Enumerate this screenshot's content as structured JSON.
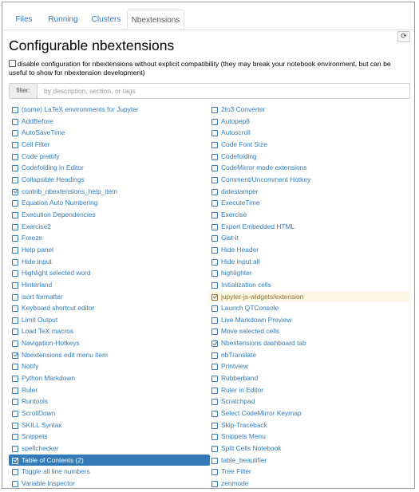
{
  "tabs": [
    {
      "label": "Files"
    },
    {
      "label": "Running"
    },
    {
      "label": "Clusters"
    },
    {
      "label": "Nbextensions",
      "active": true
    }
  ],
  "page_title": "Configurable nbextensions",
  "refresh_icon": "refresh-icon",
  "compat_checkbox": {
    "checked": false,
    "label": "disable configuration for nbextensions without explicit compatibility (they may break your notebook environment, but can be useful to show for nbextension development)"
  },
  "filter": {
    "label": "filter:",
    "value": "",
    "placeholder": "by description, section, or tags"
  },
  "colors": {
    "link": "#337ab7",
    "selected_bg": "#337ab7",
    "hover_bg": "#fcf8e3",
    "hover_text": "#8a6d3b"
  },
  "extensions_left": [
    {
      "label": "(some) LaTeX environments for Jupyter",
      "checked": false
    },
    {
      "label": "AddBefore",
      "checked": false
    },
    {
      "label": "AutoSaveTime",
      "checked": false
    },
    {
      "label": "Cell Filter",
      "checked": false
    },
    {
      "label": "Code prettify",
      "checked": false
    },
    {
      "label": "Codefolding in Editor",
      "checked": false
    },
    {
      "label": "Collapsible Headings",
      "checked": false
    },
    {
      "label": "contrib_nbextensions_help_item",
      "checked": true
    },
    {
      "label": "Equation Auto Numbering",
      "checked": false
    },
    {
      "label": "Execution Dependencies",
      "checked": false
    },
    {
      "label": "Exercise2",
      "checked": false
    },
    {
      "label": "Freeze",
      "checked": false
    },
    {
      "label": "Help panel",
      "checked": false
    },
    {
      "label": "Hide input",
      "checked": false
    },
    {
      "label": "Highlight selected word",
      "checked": false
    },
    {
      "label": "Hinterland",
      "checked": false
    },
    {
      "label": "isort formatter",
      "checked": false
    },
    {
      "label": "Keyboard shortcut editor",
      "checked": false
    },
    {
      "label": "Limit Output",
      "checked": false
    },
    {
      "label": "Load TeX macros",
      "checked": false
    },
    {
      "label": "Navigation-Hotkeys",
      "checked": false
    },
    {
      "label": "Nbextensions edit menu item",
      "checked": true
    },
    {
      "label": "Notify",
      "checked": false
    },
    {
      "label": "Python Markdown",
      "checked": false
    },
    {
      "label": "Ruler",
      "checked": false
    },
    {
      "label": "Runtools",
      "checked": false
    },
    {
      "label": "ScrollDown",
      "checked": false
    },
    {
      "label": "SKILL Syntax",
      "checked": false
    },
    {
      "label": "Snippets",
      "checked": false
    },
    {
      "label": "spellchecker",
      "checked": false
    },
    {
      "label": "Table of Contents (2)",
      "checked": true,
      "state": "selected"
    },
    {
      "label": "Toggle all line numbers",
      "checked": false
    },
    {
      "label": "Variable Inspector",
      "checked": false
    }
  ],
  "extensions_right": [
    {
      "label": "2to3 Converter",
      "checked": false
    },
    {
      "label": "Autopep8",
      "checked": false
    },
    {
      "label": "Autoscroll",
      "checked": false
    },
    {
      "label": "Code Font Size",
      "checked": false
    },
    {
      "label": "Codefolding",
      "checked": false
    },
    {
      "label": "CodeMirror mode extensions",
      "checked": false
    },
    {
      "label": "Comment/Uncomment Hotkey",
      "checked": false
    },
    {
      "label": "datestamper",
      "checked": false
    },
    {
      "label": "ExecuteTime",
      "checked": false
    },
    {
      "label": "Exercise",
      "checked": false
    },
    {
      "label": "Export Embedded HTML",
      "checked": false
    },
    {
      "label": "Gist-it",
      "checked": false
    },
    {
      "label": "Hide Header",
      "checked": false
    },
    {
      "label": "Hide input all",
      "checked": false
    },
    {
      "label": "highlighter",
      "checked": false
    },
    {
      "label": "Initialization cells",
      "checked": false
    },
    {
      "label": "jupyter-js-widgets/extension",
      "checked": true,
      "state": "hover"
    },
    {
      "label": "Launch QTConsole",
      "checked": false
    },
    {
      "label": "Live Markdown Preview",
      "checked": false
    },
    {
      "label": "Move selected cells",
      "checked": false
    },
    {
      "label": "Nbextensions dashboard tab",
      "checked": true
    },
    {
      "label": "nbTranslate",
      "checked": false
    },
    {
      "label": "Printview",
      "checked": false
    },
    {
      "label": "Rubberband",
      "checked": false
    },
    {
      "label": "Ruler in Editor",
      "checked": false
    },
    {
      "label": "Scratchpad",
      "checked": false
    },
    {
      "label": "Select CodeMirror Keymap",
      "checked": false
    },
    {
      "label": "Skip-Traceback",
      "checked": false
    },
    {
      "label": "Snippets Menu",
      "checked": false
    },
    {
      "label": "Split Cells Notebook",
      "checked": false
    },
    {
      "label": "table_beautifier",
      "checked": false
    },
    {
      "label": "Tree Filter",
      "checked": false
    },
    {
      "label": "zenmode",
      "checked": false
    }
  ]
}
